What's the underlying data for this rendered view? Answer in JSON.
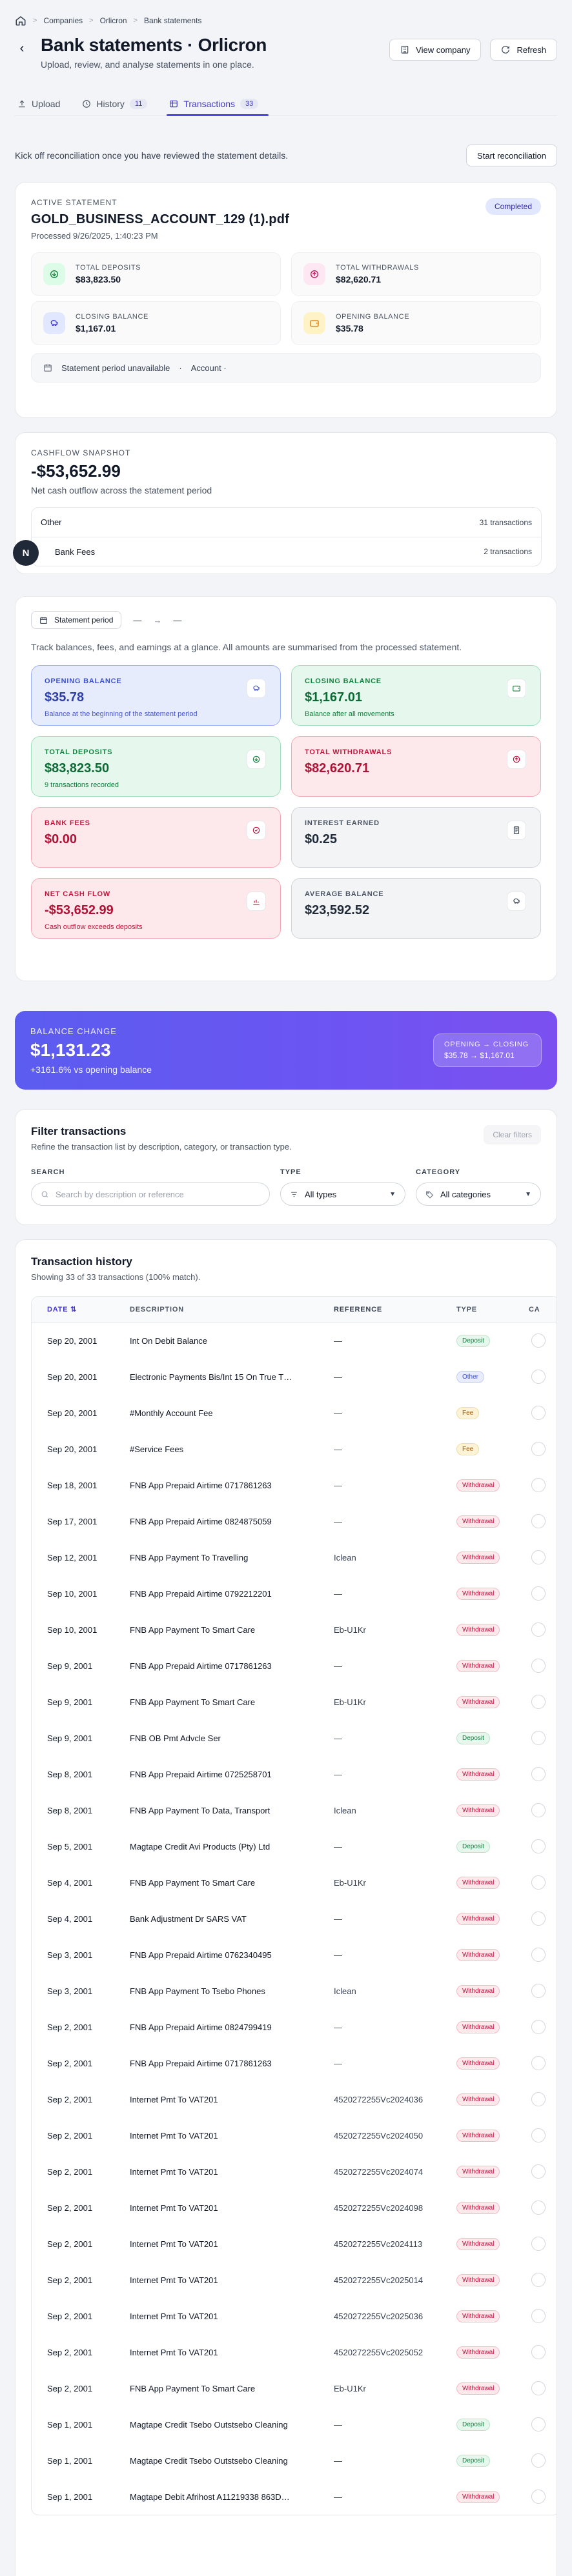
{
  "breadcrumb": [
    "Companies",
    "Orlicron",
    "Bank statements"
  ],
  "header": {
    "title": "Bank statements · Orlicron",
    "subtitle": "Upload, review, and analyse statements in one place.",
    "view_company": "View company",
    "refresh": "Refresh"
  },
  "tabs": [
    {
      "label": "Upload"
    },
    {
      "label": "History",
      "count": "11"
    },
    {
      "label": "Transactions",
      "count": "33"
    }
  ],
  "reconciliation": {
    "text": "Kick off reconciliation once you have reviewed the statement details.",
    "button": "Start reconciliation"
  },
  "statement": {
    "eyebrow": "ACTIVE STATEMENT",
    "status": "Completed",
    "name": "GOLD_BUSINESS_ACCOUNT_129 (1).pdf",
    "processed": "Processed 9/26/2025, 1:40:23 PM",
    "kpis": [
      {
        "label": "TOTAL DEPOSITS",
        "value": "$83,823.50",
        "icon": "arrow-in-icon",
        "color": "#15803d",
        "bg": "#dcfce7"
      },
      {
        "label": "TOTAL WITHDRAWALS",
        "value": "$82,620.71",
        "icon": "arrow-out-icon",
        "color": "#be185d",
        "bg": "#fce7f3"
      },
      {
        "label": "CLOSING BALANCE",
        "value": "$1,167.01",
        "icon": "piggy-bank-icon",
        "color": "#4338ca",
        "bg": "#e0e7ff"
      },
      {
        "label": "OPENING BALANCE",
        "value": "$35.78",
        "icon": "wallet-icon",
        "color": "#d97706",
        "bg": "#fef3c7"
      }
    ],
    "period_text": "Statement period unavailable",
    "account_text": "Account ·"
  },
  "cashflow": {
    "eyebrow": "CASHFLOW SNAPSHOT",
    "amount": "-$53,652.99",
    "subtitle": "Net cash outflow across the statement period",
    "rows": [
      {
        "label": "Other",
        "count": "31 transactions"
      },
      {
        "label": "Bank Fees",
        "count": "2 transactions"
      }
    ],
    "fab": "N"
  },
  "period": {
    "chip": "Statement period",
    "dash1": "—",
    "dash2": "—",
    "description": "Track balances, fees, and earnings at a glance. All amounts are summarised from the processed statement.",
    "tiles": [
      {
        "label": "OPENING BALANCE",
        "value": "$35.78",
        "sub": "Balance at the beginning of the statement period",
        "style": "blue",
        "icon": "piggy-bank-icon"
      },
      {
        "label": "CLOSING BALANCE",
        "value": "$1,167.01",
        "sub": "Balance after all movements",
        "style": "green",
        "icon": "wallet-icon"
      },
      {
        "label": "TOTAL DEPOSITS",
        "value": "$83,823.50",
        "sub": "9 transactions recorded",
        "style": "green",
        "icon": "arrow-in-icon"
      },
      {
        "label": "TOTAL WITHDRAWALS",
        "value": "$82,620.71",
        "sub": "",
        "style": "red",
        "icon": "arrow-out-icon"
      },
      {
        "label": "BANK FEES",
        "value": "$0.00",
        "sub": "",
        "style": "red",
        "icon": "receipt-icon"
      },
      {
        "label": "INTEREST EARNED",
        "value": "$0.25",
        "sub": "",
        "style": "gray",
        "icon": "document-icon"
      },
      {
        "label": "NET CASH FLOW",
        "value": "-$53,652.99",
        "sub": "Cash outflow exceeds deposits",
        "style": "red",
        "icon": "bar-chart-icon"
      },
      {
        "label": "AVERAGE BALANCE",
        "value": "$23,592.52",
        "sub": "",
        "style": "gray",
        "icon": "piggy-bank-icon"
      }
    ]
  },
  "balance_change": {
    "label": "BALANCE CHANGE",
    "value": "$1,131.23",
    "sub": "+3161.6% vs opening balance",
    "oc_label": "OPENING → CLOSING",
    "oc_value": "$35.78 → $1,167.01"
  },
  "filters": {
    "title": "Filter transactions",
    "subtitle": "Refine the transaction list by description, category, or transaction type.",
    "clear": "Clear filters",
    "search_label": "SEARCH",
    "search_placeholder": "Search by description or reference",
    "type_label": "TYPE",
    "type_value": "All types",
    "category_label": "CATEGORY",
    "category_value": "All categories"
  },
  "history": {
    "title": "Transaction history",
    "subtitle": "Showing 33 of 33 transactions (100% match).",
    "columns": [
      "DATE ⇅",
      "DESCRIPTION",
      "REFERENCE",
      "TYPE",
      "CA"
    ],
    "rows": [
      {
        "date": "Sep 20, 2001",
        "desc": "Int On Debit Balance",
        "ref": "—",
        "type": "Deposit"
      },
      {
        "date": "Sep 20, 2001",
        "desc": "Electronic Payments Bis/Int 15 On True T…",
        "ref": "—",
        "type": "Other"
      },
      {
        "date": "Sep 20, 2001",
        "desc": "#Monthly Account Fee",
        "ref": "—",
        "type": "Fee"
      },
      {
        "date": "Sep 20, 2001",
        "desc": "#Service Fees",
        "ref": "—",
        "type": "Fee"
      },
      {
        "date": "Sep 18, 2001",
        "desc": "FNB App Prepaid Airtime 0717861263",
        "ref": "—",
        "type": "Withdrawal"
      },
      {
        "date": "Sep 17, 2001",
        "desc": "FNB App Prepaid Airtime 0824875059",
        "ref": "—",
        "type": "Withdrawal"
      },
      {
        "date": "Sep 12, 2001",
        "desc": "FNB App Payment To Travelling",
        "ref": "Iclean",
        "type": "Withdrawal"
      },
      {
        "date": "Sep 10, 2001",
        "desc": "FNB App Prepaid Airtime 0792212201",
        "ref": "—",
        "type": "Withdrawal"
      },
      {
        "date": "Sep 10, 2001",
        "desc": "FNB App Payment To Smart Care",
        "ref": "Eb-U1Kr",
        "type": "Withdrawal"
      },
      {
        "date": "Sep 9, 2001",
        "desc": "FNB App Prepaid Airtime 0717861263",
        "ref": "—",
        "type": "Withdrawal"
      },
      {
        "date": "Sep 9, 2001",
        "desc": "FNB App Payment To Smart Care",
        "ref": "Eb-U1Kr",
        "type": "Withdrawal"
      },
      {
        "date": "Sep 9, 2001",
        "desc": "FNB OB Pmt Advcle Ser",
        "ref": "—",
        "type": "Deposit"
      },
      {
        "date": "Sep 8, 2001",
        "desc": "FNB App Prepaid Airtime 0725258701",
        "ref": "—",
        "type": "Withdrawal"
      },
      {
        "date": "Sep 8, 2001",
        "desc": "FNB App Payment To Data, Transport",
        "ref": "Iclean",
        "type": "Withdrawal"
      },
      {
        "date": "Sep 5, 2001",
        "desc": "Magtape Credit Avi Products (Pty) Ltd",
        "ref": "—",
        "type": "Deposit"
      },
      {
        "date": "Sep 4, 2001",
        "desc": "FNB App Payment To Smart Care",
        "ref": "Eb-U1Kr",
        "type": "Withdrawal"
      },
      {
        "date": "Sep 4, 2001",
        "desc": "Bank Adjustment Dr SARS VAT",
        "ref": "—",
        "type": "Withdrawal"
      },
      {
        "date": "Sep 3, 2001",
        "desc": "FNB App Prepaid Airtime 0762340495",
        "ref": "—",
        "type": "Withdrawal"
      },
      {
        "date": "Sep 3, 2001",
        "desc": "FNB App Payment To Tsebo Phones",
        "ref": "Iclean",
        "type": "Withdrawal"
      },
      {
        "date": "Sep 2, 2001",
        "desc": "FNB App Prepaid Airtime 0824799419",
        "ref": "—",
        "type": "Withdrawal"
      },
      {
        "date": "Sep 2, 2001",
        "desc": "FNB App Prepaid Airtime 0717861263",
        "ref": "—",
        "type": "Withdrawal"
      },
      {
        "date": "Sep 2, 2001",
        "desc": "Internet Pmt To VAT201",
        "ref": "4520272255Vc2024036",
        "type": "Withdrawal"
      },
      {
        "date": "Sep 2, 2001",
        "desc": "Internet Pmt To VAT201",
        "ref": "4520272255Vc2024050",
        "type": "Withdrawal"
      },
      {
        "date": "Sep 2, 2001",
        "desc": "Internet Pmt To VAT201",
        "ref": "4520272255Vc2024074",
        "type": "Withdrawal"
      },
      {
        "date": "Sep 2, 2001",
        "desc": "Internet Pmt To VAT201",
        "ref": "4520272255Vc2024098",
        "type": "Withdrawal"
      },
      {
        "date": "Sep 2, 2001",
        "desc": "Internet Pmt To VAT201",
        "ref": "4520272255Vc2024113",
        "type": "Withdrawal"
      },
      {
        "date": "Sep 2, 2001",
        "desc": "Internet Pmt To VAT201",
        "ref": "4520272255Vc2025014",
        "type": "Withdrawal"
      },
      {
        "date": "Sep 2, 2001",
        "desc": "Internet Pmt To VAT201",
        "ref": "4520272255Vc2025036",
        "type": "Withdrawal"
      },
      {
        "date": "Sep 2, 2001",
        "desc": "Internet Pmt To VAT201",
        "ref": "4520272255Vc2025052",
        "type": "Withdrawal"
      },
      {
        "date": "Sep 2, 2001",
        "desc": "FNB App Payment To Smart Care",
        "ref": "Eb-U1Kr",
        "type": "Withdrawal"
      },
      {
        "date": "Sep 1, 2001",
        "desc": "Magtape Credit Tsebo Outstsebo Cleaning",
        "ref": "—",
        "type": "Deposit"
      },
      {
        "date": "Sep 1, 2001",
        "desc": "Magtape Credit Tsebo Outstsebo Cleaning",
        "ref": "—",
        "type": "Deposit"
      },
      {
        "date": "Sep 1, 2001",
        "desc": "Magtape Debit Afrihost A11219338 863D…",
        "ref": "—",
        "type": "Withdrawal"
      }
    ]
  }
}
